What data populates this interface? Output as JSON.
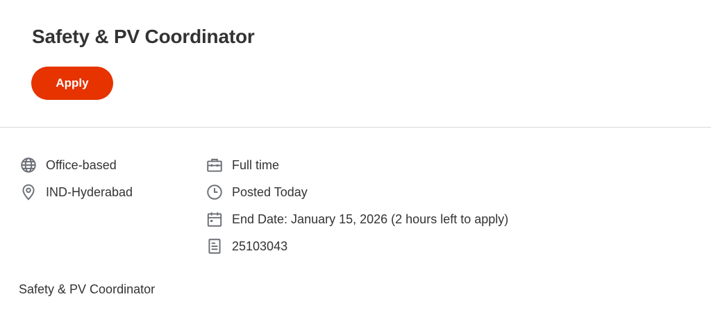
{
  "job": {
    "title": "Safety & PV Coordinator",
    "apply_label": "Apply"
  },
  "details": {
    "work_mode": {
      "icon": "globe-icon",
      "text": "Office-based"
    },
    "location": {
      "icon": "location-pin-icon",
      "text": "IND-Hyderabad"
    },
    "time_type": {
      "icon": "briefcase-icon",
      "text": "Full time"
    },
    "posted": {
      "icon": "clock-icon",
      "text": "Posted Today"
    },
    "end_date": {
      "icon": "calendar-icon",
      "text": "End Date: January 15, 2026 (2 hours left to apply)"
    },
    "job_id": {
      "icon": "document-icon",
      "text": "25103043"
    }
  },
  "description": {
    "text": "Safety & PV Coordinator"
  },
  "colors": {
    "apply_button": "#e63300",
    "text": "#333333",
    "icon": "#6b6f75",
    "divider": "#d9d9d9"
  }
}
